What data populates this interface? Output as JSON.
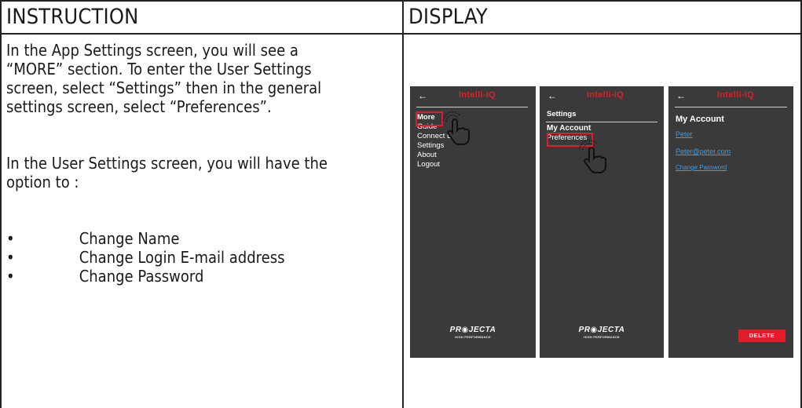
{
  "table": {
    "instruction_header": "INSTRUCTION",
    "display_header": "DISPLAY"
  },
  "instruction": {
    "para1": [
      "In the App Settings screen, you will see a",
      "“MORE” section. To enter the User Settings",
      "screen, select “Settings” then in the general",
      "settings screen, select “Preferences”."
    ],
    "para2": [
      "In the User Settings screen, you will have the",
      "option to :"
    ],
    "bullet_symbol": "•",
    "bullets": [
      "Change Name",
      "Change Login E-mail address",
      "Change Password"
    ]
  },
  "screens": [
    {
      "back_icon": "arrow-left-icon",
      "back": "←",
      "brand": "Intelli-IQ",
      "items": [
        "More",
        "Guide",
        "Connect D",
        "Settings",
        "About",
        "Logout"
      ],
      "highlighted": "More",
      "logo": "PR◉JECTA",
      "logo_sub": "HIGH PERFORMANCE"
    },
    {
      "back_icon": "arrow-left-icon",
      "back": "←",
      "brand": "Intelli-IQ",
      "section": "Settings",
      "items": [
        "My Account",
        "Preferences"
      ],
      "highlighted": "Preferences",
      "logo": "PR◉JECTA",
      "logo_sub": "HIGH PERFORMANCE"
    },
    {
      "back_icon": "arrow-left-icon",
      "back": "←",
      "brand": "Intelli-IQ",
      "title": "My Account",
      "name_link": "Peter",
      "email_link": "Peter@peter.com",
      "password_link": "Change Password",
      "delete_label": "DELETE"
    }
  ],
  "colors": {
    "accent": "#e11d2a",
    "screen_bg": "#3a3a3a",
    "link": "#3d9ee8"
  }
}
